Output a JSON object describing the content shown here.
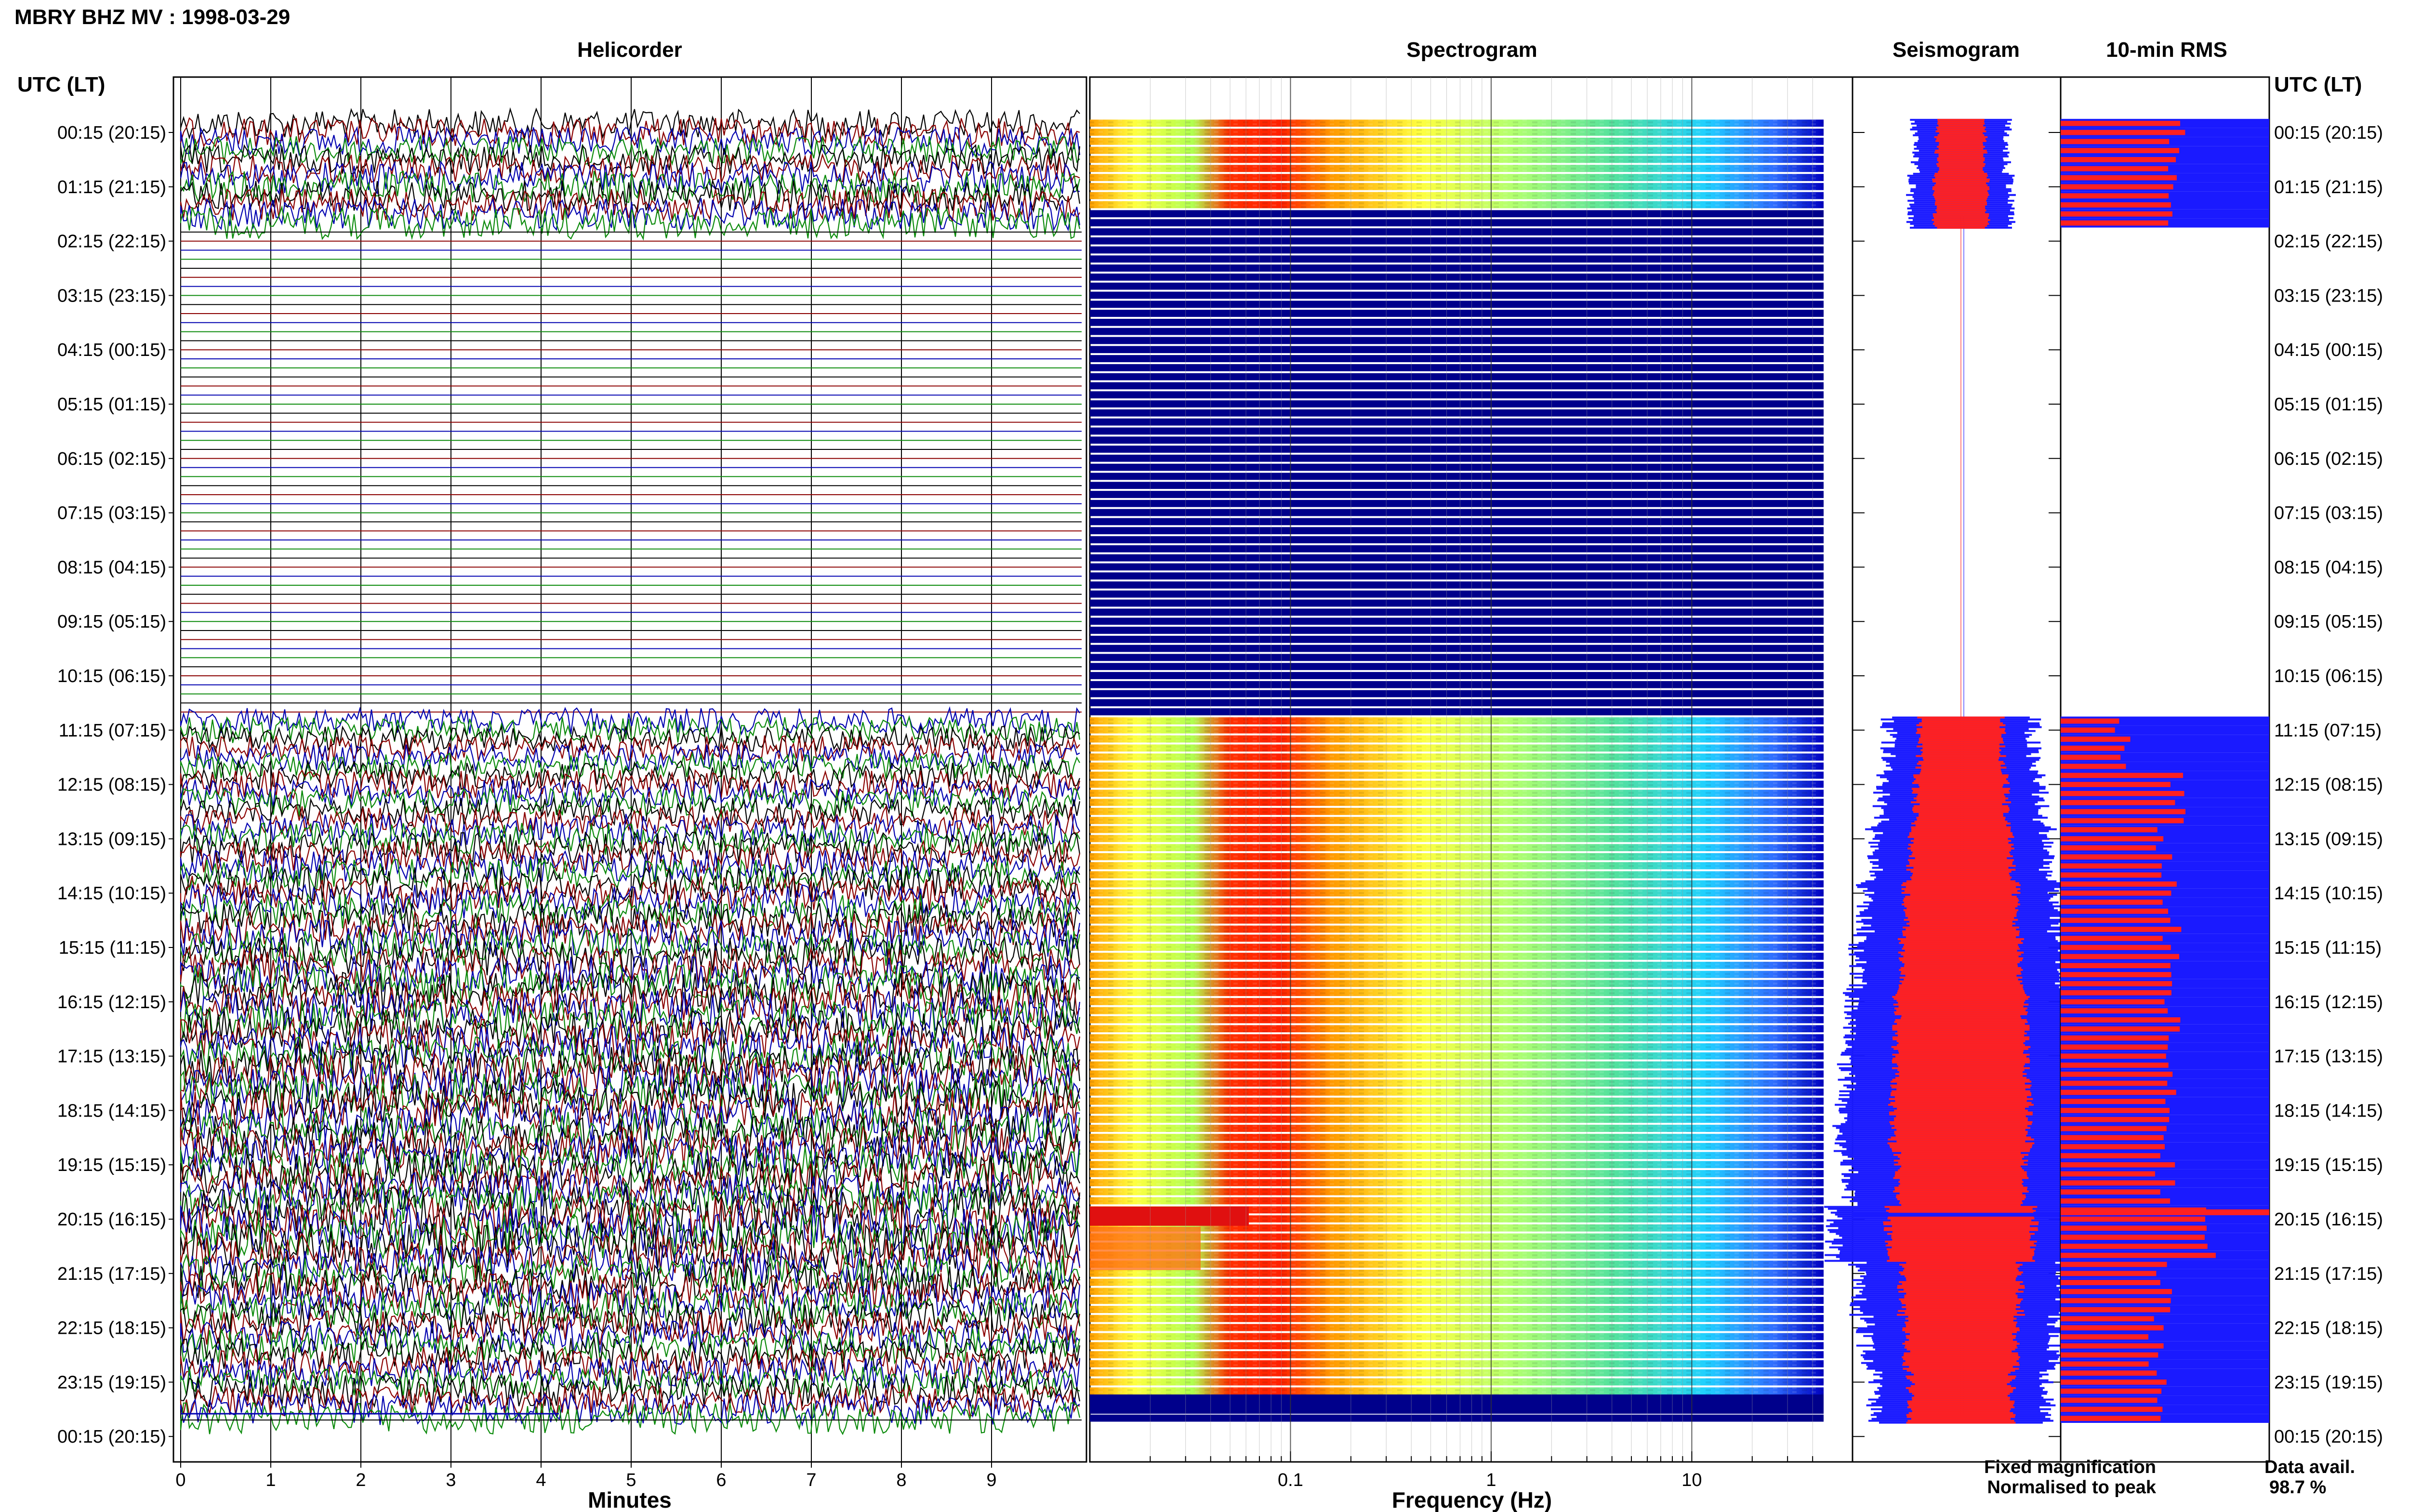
{
  "title": "MBRY BHZ MV : 1998-03-29",
  "panels": {
    "helicorder": "Helicorder",
    "spectrogram": "Spectrogram",
    "seismogram": "Seismogram",
    "rms": "10-min RMS"
  },
  "time_axis_label": "UTC (LT)",
  "time_labels": [
    "00:15 (20:15)",
    "01:15 (21:15)",
    "02:15 (22:15)",
    "03:15 (23:15)",
    "04:15 (00:15)",
    "05:15 (01:15)",
    "06:15 (02:15)",
    "07:15 (03:15)",
    "08:15 (04:15)",
    "09:15 (05:15)",
    "10:15 (06:15)",
    "11:15 (07:15)",
    "12:15 (08:15)",
    "13:15 (09:15)",
    "14:15 (10:15)",
    "15:15 (11:15)",
    "16:15 (12:15)",
    "17:15 (13:15)",
    "18:15 (14:15)",
    "19:15 (15:15)",
    "20:15 (16:15)",
    "21:15 (17:15)",
    "22:15 (18:15)",
    "23:15 (19:15)",
    "00:15 (20:15)"
  ],
  "helicorder_xaxis": {
    "label": "Minutes",
    "ticks": [
      "0",
      "1",
      "2",
      "3",
      "4",
      "5",
      "6",
      "7",
      "8",
      "9"
    ]
  },
  "spectrogram_xaxis": {
    "label": "Frequency (Hz)",
    "ticks": [
      "0.1",
      "1",
      "10"
    ],
    "scale": "log"
  },
  "legend": {
    "fixed": "Fixed magnification",
    "normalised": "Normalised to peak",
    "fixed_color": "#1a1aff",
    "normalised_color": "#ff2020"
  },
  "data_availability": {
    "label": "Data avail.",
    "value": "98.7 %"
  },
  "colors": {
    "trace_cycle": [
      "#000000",
      "#8b0000",
      "#0000b0",
      "#0a8a0a"
    ],
    "spectrogram_low": "#00008b",
    "spectrogram_high": "#ff2000"
  },
  "chart_data": [
    {
      "type": "line",
      "name": "helicorder",
      "xlabel": "Minutes",
      "xlim": [
        0,
        10
      ],
      "rows_per_hour": 6,
      "traces": 144,
      "data_gaps": [
        [
          "02:00",
          "11:00"
        ],
        [
          "00:00 next day",
          "00:15 next day"
        ]
      ],
      "amplitude_level": [
        {
          "hour": "00",
          "level": 0.5
        },
        {
          "hour": "01",
          "level": 0.55
        },
        {
          "hour": "11",
          "level": 0.45
        },
        {
          "hour": "12",
          "level": 0.5
        },
        {
          "hour": "13",
          "level": 0.55
        },
        {
          "hour": "14",
          "level": 0.6
        },
        {
          "hour": "15",
          "level": 0.65
        },
        {
          "hour": "16",
          "level": 0.7
        },
        {
          "hour": "17",
          "level": 0.72
        },
        {
          "hour": "18",
          "level": 0.75
        },
        {
          "hour": "19",
          "level": 0.7
        },
        {
          "hour": "20",
          "level": 0.8
        },
        {
          "hour": "21",
          "level": 0.65
        },
        {
          "hour": "22",
          "level": 0.6
        },
        {
          "hour": "23",
          "level": 0.55
        }
      ]
    },
    {
      "type": "heatmap",
      "name": "spectrogram",
      "xlabel": "Frequency (Hz)",
      "xscale": "log",
      "xlim": [
        0.01,
        40
      ],
      "peak_band_hz": [
        0.2,
        0.6
      ],
      "no_data_hours": [
        "02",
        "03",
        "04",
        "05",
        "06",
        "07",
        "08",
        "09",
        "10",
        "23:45-00:15"
      ]
    },
    {
      "type": "bar",
      "name": "10-min RMS",
      "orientation": "horizontal",
      "series": [
        {
          "name": "Fixed magnification",
          "color": "#1a1aff"
        },
        {
          "name": "Normalised to peak",
          "color": "#ff2020"
        }
      ],
      "categories": [
        "00:15",
        "01:15",
        "11:15",
        "12:15",
        "13:15",
        "14:15",
        "15:15",
        "16:15",
        "17:15",
        "18:15",
        "19:15",
        "20:15",
        "21:15",
        "22:15",
        "23:15"
      ],
      "values": [
        0.55,
        0.52,
        0.3,
        0.55,
        0.5,
        0.53,
        0.52,
        0.53,
        0.51,
        0.52,
        0.5,
        0.7,
        0.49,
        0.47,
        0.48
      ],
      "xlim": [
        0,
        1
      ]
    }
  ]
}
